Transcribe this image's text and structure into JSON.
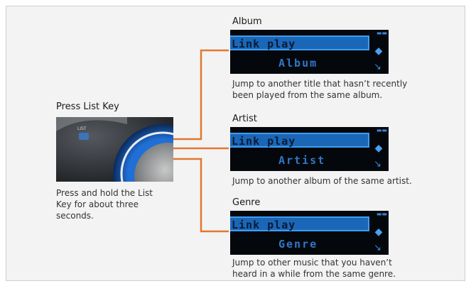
{
  "press": {
    "title": "Press List Key",
    "description_lines": [
      "Press and hold the List",
      "Key for about three",
      "seconds."
    ],
    "knob_label": "LIST"
  },
  "options": [
    {
      "title": "Album",
      "screen_text": "Link play",
      "screen_mode": "Album",
      "desc_lines": [
        "Jump to another title that hasn’t recently",
        "been played from the same album."
      ]
    },
    {
      "title": "Artist",
      "screen_text": "Link play",
      "screen_mode": "Artist",
      "desc_lines": [
        "Jump to another album of the same artist."
      ]
    },
    {
      "title": "Genre",
      "screen_text": "Link play",
      "screen_mode": "Genre",
      "desc_lines": [
        "Jump to other music that you haven’t",
        "heard in a while from the same genre."
      ]
    }
  ],
  "colors": {
    "connector": "#e2782f",
    "screen_bg": "#04070c",
    "screen_highlight": "#1a67b8"
  }
}
